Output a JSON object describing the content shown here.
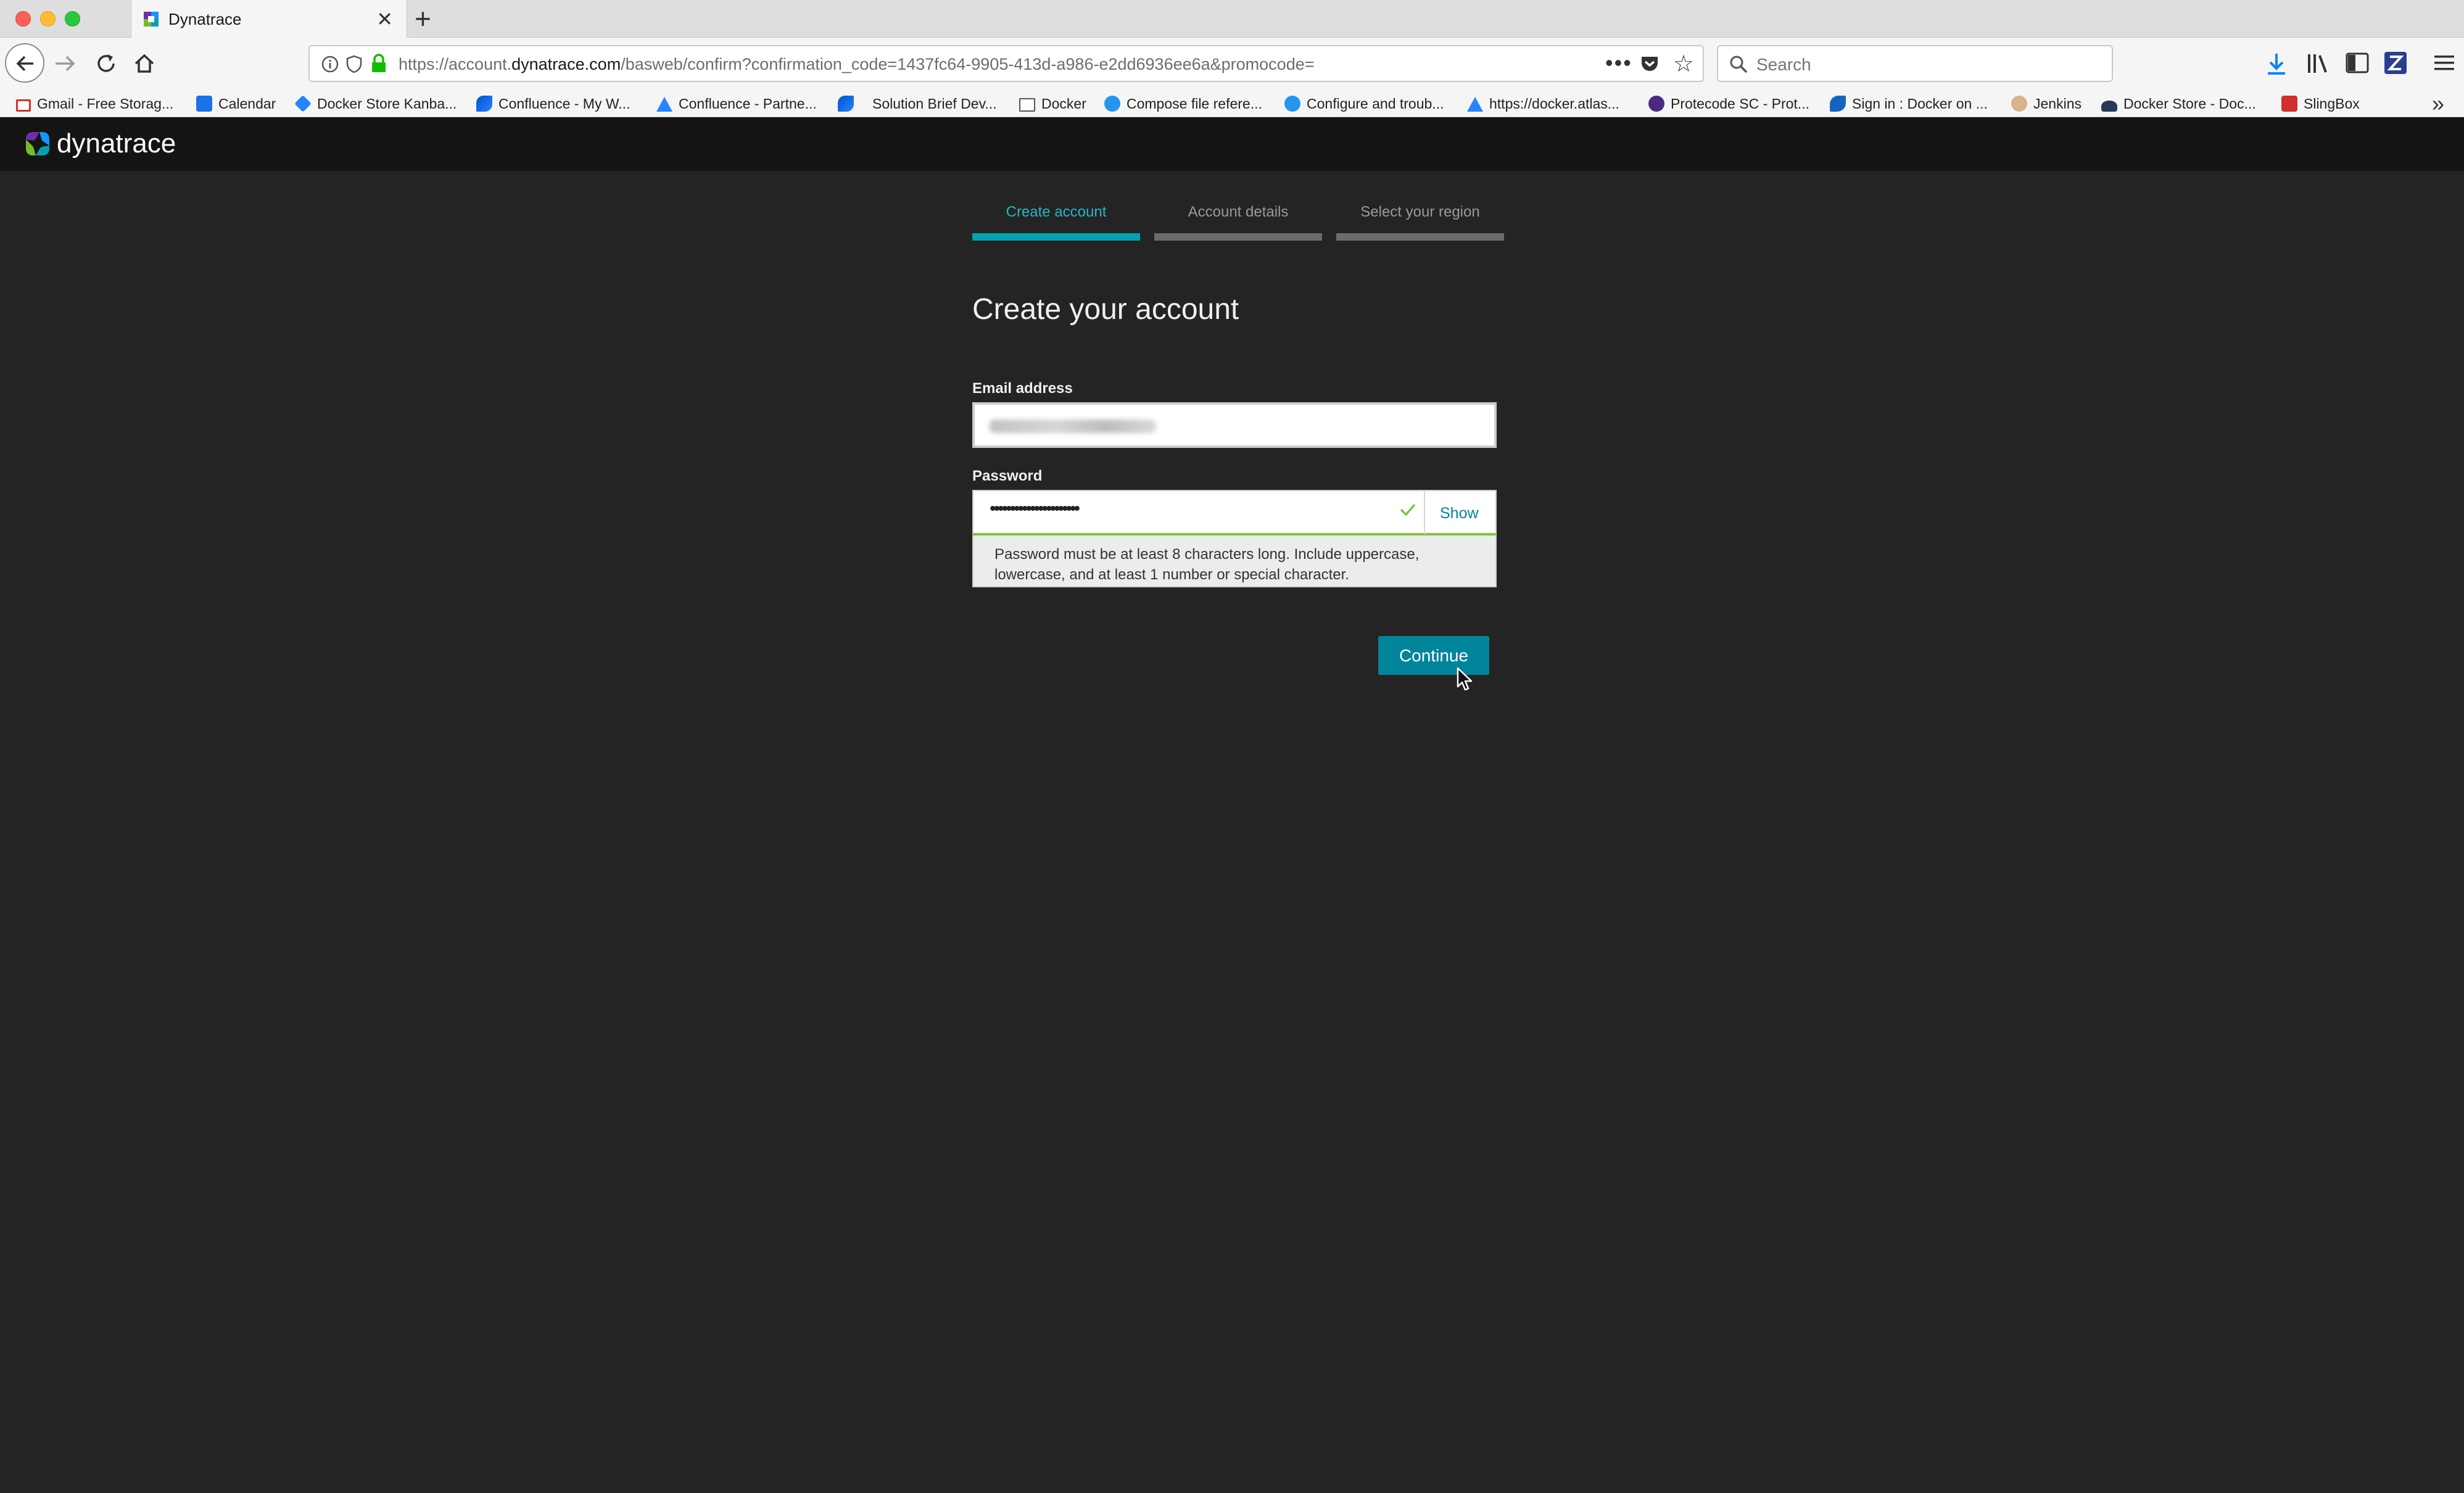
{
  "browser": {
    "tab_title": "Dynatrace",
    "url_prefix": "https://account.",
    "url_domain": "dynatrace.com",
    "url_path": "/basweb/confirm?confirmation_code=1437fc64-9905-413d-a986-e2dd6936ee6a&promocode=",
    "search_placeholder": "Search",
    "bookmarks": [
      "Gmail - Free Storag...",
      "Calendar",
      "Docker Store Kanba...",
      "Confluence - My W...",
      "Confluence - Partne...",
      "Solution Brief Dev...",
      "Docker",
      "Compose file refere...",
      "Configure and troub...",
      "https://docker.atlas...",
      "Protecode SC - Prot...",
      "Sign in : Docker on ...",
      "Jenkins",
      "Docker Store - Doc...",
      "SlingBox"
    ]
  },
  "app": {
    "logo_text": "dynatrace",
    "steps": [
      {
        "label": "Create account",
        "active": true
      },
      {
        "label": "Account details",
        "active": false
      },
      {
        "label": "Select your region",
        "active": false
      }
    ],
    "form": {
      "title": "Create your account",
      "email_label": "Email address",
      "password_label": "Password",
      "password_masked": "••••••••••••••••••••••",
      "show_label": "Show",
      "hint_line1": "Password must be at least 8 characters long. Include uppercase,",
      "hint_line2": "lowercase, and at least 1 number or special character.",
      "continue_label": "Continue"
    }
  },
  "colors": {
    "accent": "#00859a",
    "step_active": "#00a1b2",
    "valid": "#7dc540",
    "page_bg": "#242424",
    "header_bg": "#141414"
  }
}
